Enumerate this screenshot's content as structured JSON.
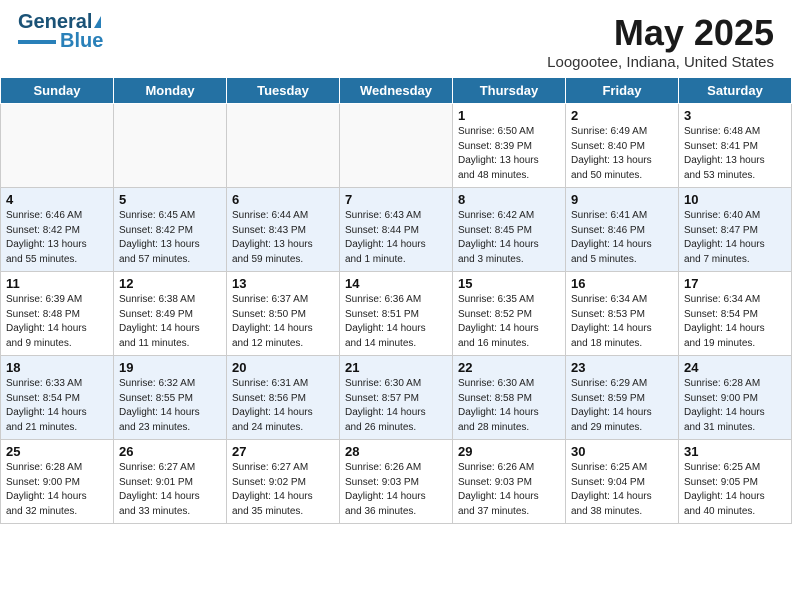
{
  "header": {
    "logo_line1": "General",
    "logo_line2": "Blue",
    "month": "May 2025",
    "location": "Loogootee, Indiana, United States"
  },
  "days_of_week": [
    "Sunday",
    "Monday",
    "Tuesday",
    "Wednesday",
    "Thursday",
    "Friday",
    "Saturday"
  ],
  "weeks": [
    [
      {
        "day": "",
        "info": ""
      },
      {
        "day": "",
        "info": ""
      },
      {
        "day": "",
        "info": ""
      },
      {
        "day": "",
        "info": ""
      },
      {
        "day": "1",
        "info": "Sunrise: 6:50 AM\nSunset: 8:39 PM\nDaylight: 13 hours\nand 48 minutes."
      },
      {
        "day": "2",
        "info": "Sunrise: 6:49 AM\nSunset: 8:40 PM\nDaylight: 13 hours\nand 50 minutes."
      },
      {
        "day": "3",
        "info": "Sunrise: 6:48 AM\nSunset: 8:41 PM\nDaylight: 13 hours\nand 53 minutes."
      }
    ],
    [
      {
        "day": "4",
        "info": "Sunrise: 6:46 AM\nSunset: 8:42 PM\nDaylight: 13 hours\nand 55 minutes."
      },
      {
        "day": "5",
        "info": "Sunrise: 6:45 AM\nSunset: 8:42 PM\nDaylight: 13 hours\nand 57 minutes."
      },
      {
        "day": "6",
        "info": "Sunrise: 6:44 AM\nSunset: 8:43 PM\nDaylight: 13 hours\nand 59 minutes."
      },
      {
        "day": "7",
        "info": "Sunrise: 6:43 AM\nSunset: 8:44 PM\nDaylight: 14 hours\nand 1 minute."
      },
      {
        "day": "8",
        "info": "Sunrise: 6:42 AM\nSunset: 8:45 PM\nDaylight: 14 hours\nand 3 minutes."
      },
      {
        "day": "9",
        "info": "Sunrise: 6:41 AM\nSunset: 8:46 PM\nDaylight: 14 hours\nand 5 minutes."
      },
      {
        "day": "10",
        "info": "Sunrise: 6:40 AM\nSunset: 8:47 PM\nDaylight: 14 hours\nand 7 minutes."
      }
    ],
    [
      {
        "day": "11",
        "info": "Sunrise: 6:39 AM\nSunset: 8:48 PM\nDaylight: 14 hours\nand 9 minutes."
      },
      {
        "day": "12",
        "info": "Sunrise: 6:38 AM\nSunset: 8:49 PM\nDaylight: 14 hours\nand 11 minutes."
      },
      {
        "day": "13",
        "info": "Sunrise: 6:37 AM\nSunset: 8:50 PM\nDaylight: 14 hours\nand 12 minutes."
      },
      {
        "day": "14",
        "info": "Sunrise: 6:36 AM\nSunset: 8:51 PM\nDaylight: 14 hours\nand 14 minutes."
      },
      {
        "day": "15",
        "info": "Sunrise: 6:35 AM\nSunset: 8:52 PM\nDaylight: 14 hours\nand 16 minutes."
      },
      {
        "day": "16",
        "info": "Sunrise: 6:34 AM\nSunset: 8:53 PM\nDaylight: 14 hours\nand 18 minutes."
      },
      {
        "day": "17",
        "info": "Sunrise: 6:34 AM\nSunset: 8:54 PM\nDaylight: 14 hours\nand 19 minutes."
      }
    ],
    [
      {
        "day": "18",
        "info": "Sunrise: 6:33 AM\nSunset: 8:54 PM\nDaylight: 14 hours\nand 21 minutes."
      },
      {
        "day": "19",
        "info": "Sunrise: 6:32 AM\nSunset: 8:55 PM\nDaylight: 14 hours\nand 23 minutes."
      },
      {
        "day": "20",
        "info": "Sunrise: 6:31 AM\nSunset: 8:56 PM\nDaylight: 14 hours\nand 24 minutes."
      },
      {
        "day": "21",
        "info": "Sunrise: 6:30 AM\nSunset: 8:57 PM\nDaylight: 14 hours\nand 26 minutes."
      },
      {
        "day": "22",
        "info": "Sunrise: 6:30 AM\nSunset: 8:58 PM\nDaylight: 14 hours\nand 28 minutes."
      },
      {
        "day": "23",
        "info": "Sunrise: 6:29 AM\nSunset: 8:59 PM\nDaylight: 14 hours\nand 29 minutes."
      },
      {
        "day": "24",
        "info": "Sunrise: 6:28 AM\nSunset: 9:00 PM\nDaylight: 14 hours\nand 31 minutes."
      }
    ],
    [
      {
        "day": "25",
        "info": "Sunrise: 6:28 AM\nSunset: 9:00 PM\nDaylight: 14 hours\nand 32 minutes."
      },
      {
        "day": "26",
        "info": "Sunrise: 6:27 AM\nSunset: 9:01 PM\nDaylight: 14 hours\nand 33 minutes."
      },
      {
        "day": "27",
        "info": "Sunrise: 6:27 AM\nSunset: 9:02 PM\nDaylight: 14 hours\nand 35 minutes."
      },
      {
        "day": "28",
        "info": "Sunrise: 6:26 AM\nSunset: 9:03 PM\nDaylight: 14 hours\nand 36 minutes."
      },
      {
        "day": "29",
        "info": "Sunrise: 6:26 AM\nSunset: 9:03 PM\nDaylight: 14 hours\nand 37 minutes."
      },
      {
        "day": "30",
        "info": "Sunrise: 6:25 AM\nSunset: 9:04 PM\nDaylight: 14 hours\nand 38 minutes."
      },
      {
        "day": "31",
        "info": "Sunrise: 6:25 AM\nSunset: 9:05 PM\nDaylight: 14 hours\nand 40 minutes."
      }
    ]
  ]
}
